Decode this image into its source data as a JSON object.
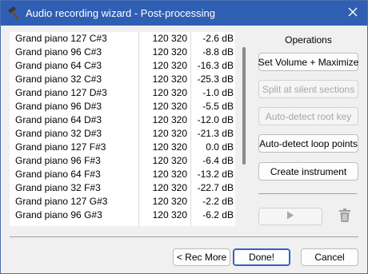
{
  "window": {
    "title": "Audio recording wizard - Post-processing",
    "app_icon": "hammer-icon",
    "close_icon": "close-icon"
  },
  "samples": [
    {
      "name": "Grand piano 127 C#3",
      "count": "120 320",
      "level": "-2.6 dB"
    },
    {
      "name": "Grand piano 96 C#3",
      "count": "120 320",
      "level": "-8.8 dB"
    },
    {
      "name": "Grand piano 64 C#3",
      "count": "120 320",
      "level": "-16.3 dB"
    },
    {
      "name": "Grand piano 32 C#3",
      "count": "120 320",
      "level": "-25.3 dB"
    },
    {
      "name": "Grand piano 127 D#3",
      "count": "120 320",
      "level": "-1.0 dB"
    },
    {
      "name": "Grand piano 96 D#3",
      "count": "120 320",
      "level": "-5.5 dB"
    },
    {
      "name": "Grand piano 64 D#3",
      "count": "120 320",
      "level": "-12.0 dB"
    },
    {
      "name": "Grand piano 32 D#3",
      "count": "120 320",
      "level": "-21.3 dB"
    },
    {
      "name": "Grand piano 127 F#3",
      "count": "120 320",
      "level": "0.0 dB"
    },
    {
      "name": "Grand piano 96 F#3",
      "count": "120 320",
      "level": "-6.4 dB"
    },
    {
      "name": "Grand piano 64 F#3",
      "count": "120 320",
      "level": "-13.2 dB"
    },
    {
      "name": "Grand piano 32 F#3",
      "count": "120 320",
      "level": "-22.7 dB"
    },
    {
      "name": "Grand piano 127 G#3",
      "count": "120 320",
      "level": "-2.2 dB"
    },
    {
      "name": "Grand piano 96 G#3",
      "count": "120 320",
      "level": "-6.2 dB"
    }
  ],
  "operations": {
    "heading": "Operations",
    "set_volume": "Set Volume + Maximize",
    "split_silent": "Split at silent sections",
    "detect_root": "Auto-detect root key",
    "detect_loop": "Auto-detect loop points",
    "create_instrument": "Create instrument",
    "play_icon": "play-icon",
    "delete_icon": "trash-icon"
  },
  "footer": {
    "back": "< Rec More",
    "done": "Done!",
    "cancel": "Cancel"
  },
  "colors": {
    "titlebar": "#2f5fb3",
    "default_button_border": "#2f63c4"
  }
}
